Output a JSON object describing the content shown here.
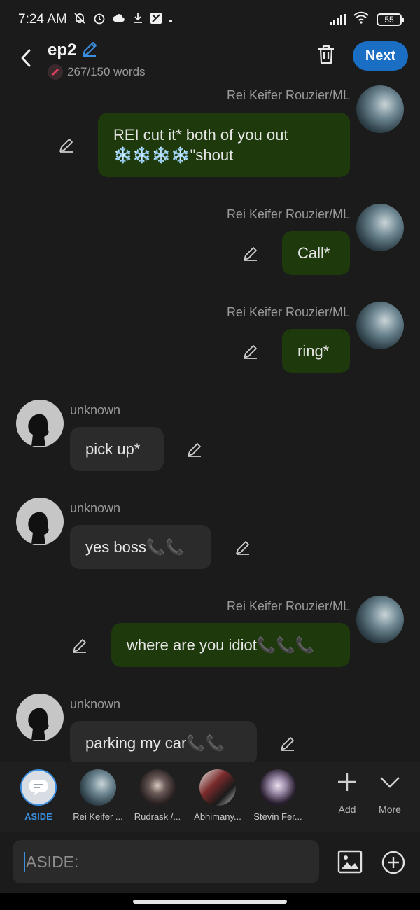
{
  "status": {
    "time": "7:24 AM",
    "battery": "55"
  },
  "header": {
    "title": "ep2",
    "word_count": "267/150 words",
    "next_label": "Next"
  },
  "messages": [
    {
      "sender": "Rei Keifer Rouzier/ML",
      "text": "REI cut it* both of you out ❄️❄️❄️❄️\"shout",
      "side": "out"
    },
    {
      "sender": "Rei Keifer Rouzier/ML",
      "text": "Call*",
      "side": "out"
    },
    {
      "sender": "Rei Keifer Rouzier/ML",
      "text": "ring*",
      "side": "out"
    },
    {
      "sender": "unknown",
      "text": "pick up*",
      "side": "in"
    },
    {
      "sender": "unknown",
      "text": "yes boss📞📞",
      "side": "in"
    },
    {
      "sender": "Rei Keifer Rouzier/ML",
      "text": "where are you idiot📞📞📞",
      "side": "out"
    },
    {
      "sender": "unknown",
      "text": "parking my car📞📞",
      "side": "in"
    }
  ],
  "characters": [
    {
      "label": "ASIDE",
      "icon": "message-icon"
    },
    {
      "label": "Rei Keifer ..."
    },
    {
      "label": "Rudrask /..."
    },
    {
      "label": "Abhimany..."
    },
    {
      "label": "Stevin Fer..."
    }
  ],
  "tools": {
    "add_label": "Add",
    "more_label": "More"
  },
  "input": {
    "value": "ASIDE:"
  },
  "colors": {
    "accent": "#1a6fc4",
    "outgoing_bubble": "#1e3a0d",
    "incoming_bubble": "#2b2b2b",
    "background": "#1b1b1b"
  }
}
